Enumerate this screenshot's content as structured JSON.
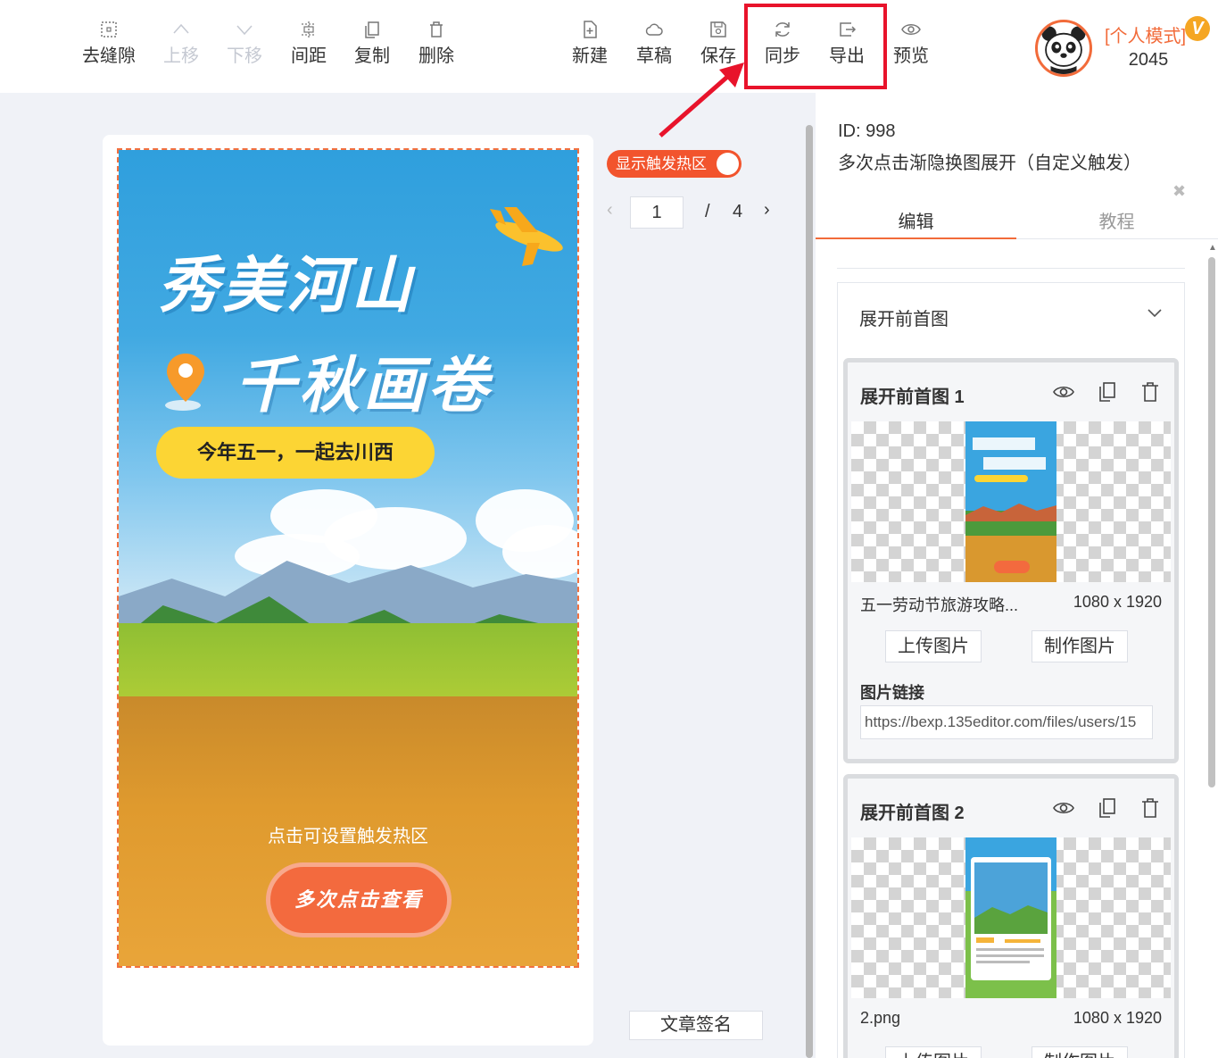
{
  "toolbar": {
    "items": [
      {
        "label": "去缝隙",
        "icon": "grid-icon",
        "disabled": false
      },
      {
        "label": "上移",
        "icon": "chevron-up-icon",
        "disabled": true
      },
      {
        "label": "下移",
        "icon": "chevron-down-icon",
        "disabled": true
      },
      {
        "label": "间距",
        "icon": "spacing-icon",
        "disabled": false
      },
      {
        "label": "复制",
        "icon": "copy-icon",
        "disabled": false
      },
      {
        "label": "删除",
        "icon": "trash-icon",
        "disabled": false
      },
      {
        "label": "新建",
        "icon": "new-file-icon",
        "disabled": false
      },
      {
        "label": "草稿",
        "icon": "cloud-icon",
        "disabled": false
      },
      {
        "label": "保存",
        "icon": "save-icon",
        "disabled": false
      },
      {
        "label": "同步",
        "icon": "sync-icon",
        "disabled": false
      },
      {
        "label": "导出",
        "icon": "export-icon",
        "disabled": false
      },
      {
        "label": "预览",
        "icon": "eye-icon",
        "disabled": false
      }
    ],
    "highlight_color": "#e8132b"
  },
  "user": {
    "mode": "[个人模式]",
    "badge": "V",
    "score": "2045",
    "accent": "#f26b3a"
  },
  "canvas": {
    "poster": {
      "title_line1": "秀美河山",
      "title_line2": "千秋画卷",
      "tagline": "今年五一，一起去川西",
      "hotzone_hint": "点击可设置触发热区",
      "cta_label": "多次点击查看"
    },
    "toggle_label": "显示触发热区",
    "pager": {
      "current": "1",
      "separator": "/",
      "total": "4"
    },
    "signature_button": "文章签名"
  },
  "panel": {
    "id_text": "ID: 998",
    "title": "多次点击渐隐换图展开（自定义触发）",
    "tabs": [
      {
        "label": "编辑",
        "active": true
      },
      {
        "label": "教程",
        "active": false
      }
    ],
    "section_title": "展开前首图",
    "cards": [
      {
        "title": "展开前首图 1",
        "file_name": "五一劳动节旅游攻略...",
        "dimensions": "1080 x 1920",
        "upload_label": "上传图片",
        "make_label": "制作图片",
        "link_label": "图片链接",
        "link_value": "https://bexp.135editor.com/files/users/15"
      },
      {
        "title": "展开前首图 2",
        "file_name": "2.png",
        "dimensions": "1080 x 1920",
        "upload_label": "上传图片",
        "make_label": "制作图片"
      }
    ]
  }
}
